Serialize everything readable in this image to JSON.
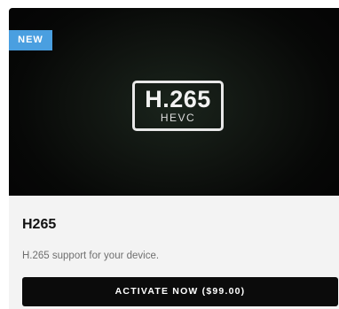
{
  "product": {
    "badge": "NEW",
    "logo_main": "H.265",
    "logo_sub": "HEVC",
    "title": "H265",
    "description": "H.265 support for your device.",
    "activate_label": "ACTIVATE NOW ($99.00)"
  },
  "colors": {
    "badge_bg": "#4a9fe0",
    "button_bg": "#0b0b0b",
    "card_bg": "#f3f3f3"
  }
}
